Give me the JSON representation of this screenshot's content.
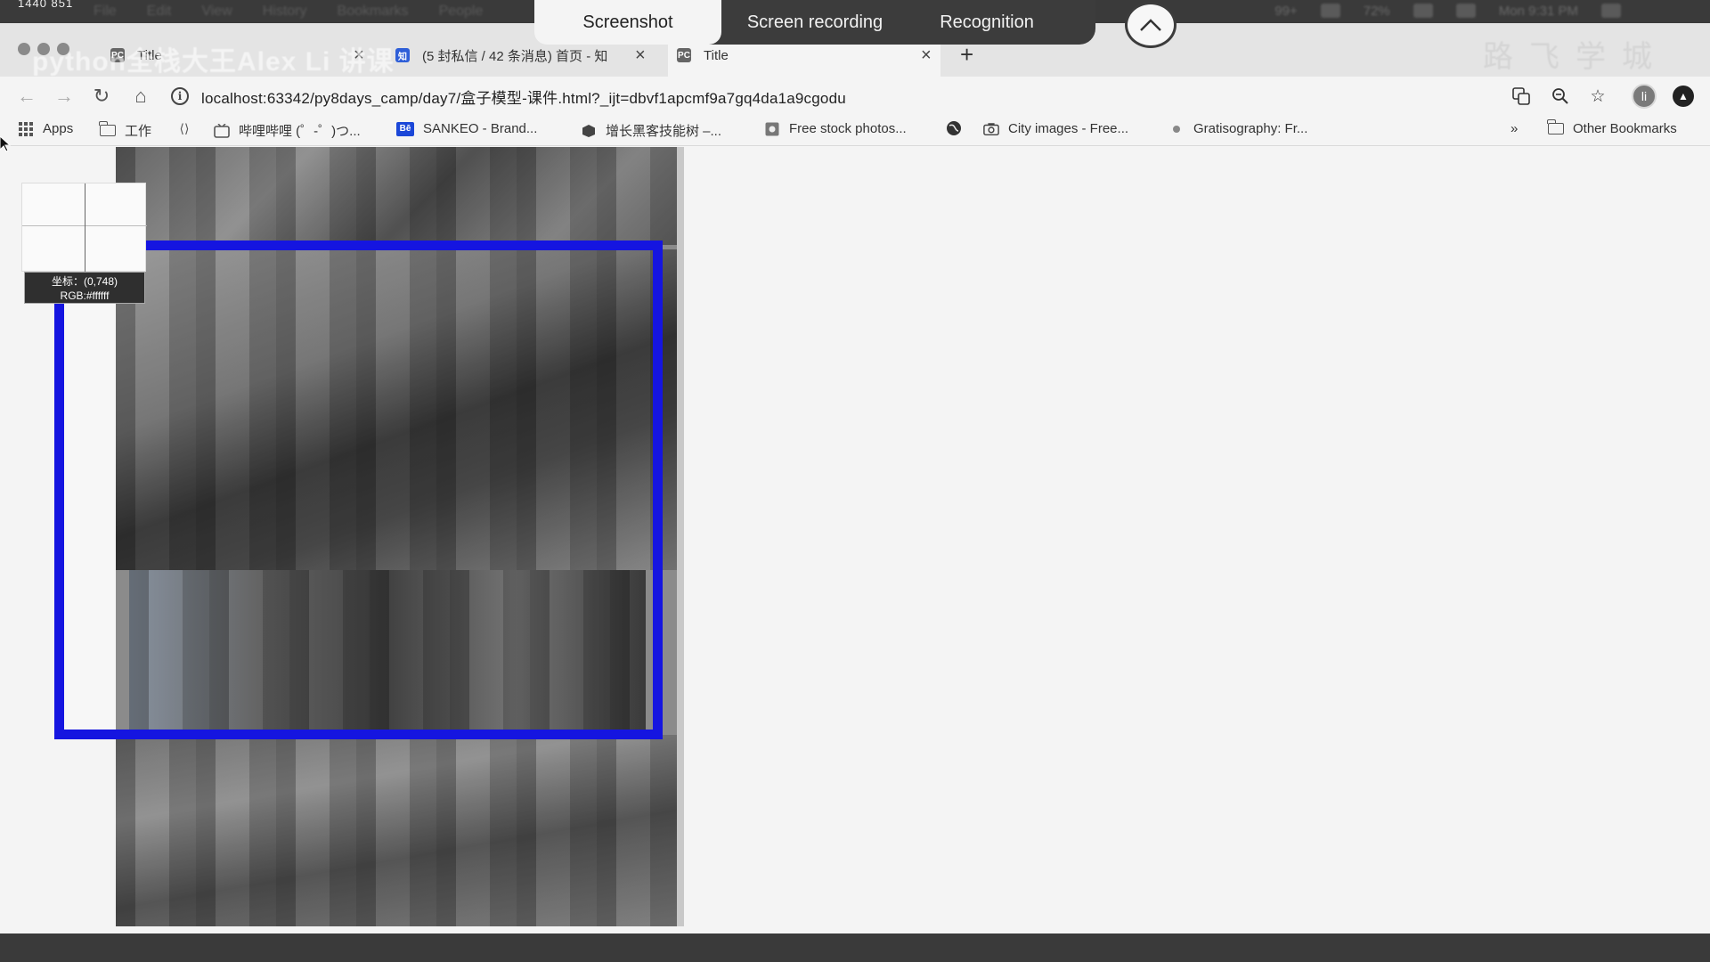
{
  "menubar": {
    "dims": "1440   851",
    "items": [
      "",
      "File",
      "Edit",
      "View",
      "History",
      "Bookmarks",
      "People"
    ],
    "status": [
      "99+",
      "72%",
      "Mon 9:31 PM"
    ]
  },
  "capture_toolbar": {
    "screenshot": "Screenshot",
    "recording": "Screen recording",
    "recognition": "Recognition"
  },
  "tabs": [
    {
      "title": "Title",
      "favicon": "PC"
    },
    {
      "title": "(5 封私信 / 42 条消息) 首页 - 知",
      "favicon": "知"
    },
    {
      "title": "Title",
      "favicon": "PC"
    }
  ],
  "watermark": {
    "course_title": "python全栈大王Alex Li 讲课",
    "brand": "路飞学城"
  },
  "address": {
    "url": "localhost:63342/py8days_camp/day7/盒子模型-课件.html?_ijt=dbvf1apcmf9a7gq4da1a9cgodu"
  },
  "avatar_letter": "li",
  "bookmarks": {
    "apps": "Apps",
    "items": [
      {
        "label": "工作",
        "icon": "folder-icon"
      },
      {
        "label": "",
        "icon": "code-icon"
      },
      {
        "label": "哔哩哔哩 (゜-゜)つ...",
        "icon": "tv-icon"
      },
      {
        "label": "SANKEO - Brand...",
        "icon": "behance-icon"
      },
      {
        "label": "增长黑客技能树 –...",
        "icon": "box-icon"
      },
      {
        "label": "Free stock photos...",
        "icon": "image-icon"
      },
      {
        "label": "",
        "icon": "globe-icon"
      },
      {
        "label": "City images - Free...",
        "icon": "camera-icon"
      },
      {
        "label": "Gratisography: Fr...",
        "icon": "dot-icon"
      }
    ],
    "overflow": "»",
    "other": "Other Bookmarks"
  },
  "capture_overlay": {
    "coord_label": "坐标：(0,748)",
    "rgb_label": "RGB:#ffffff",
    "selection_color": "#1515e0"
  }
}
